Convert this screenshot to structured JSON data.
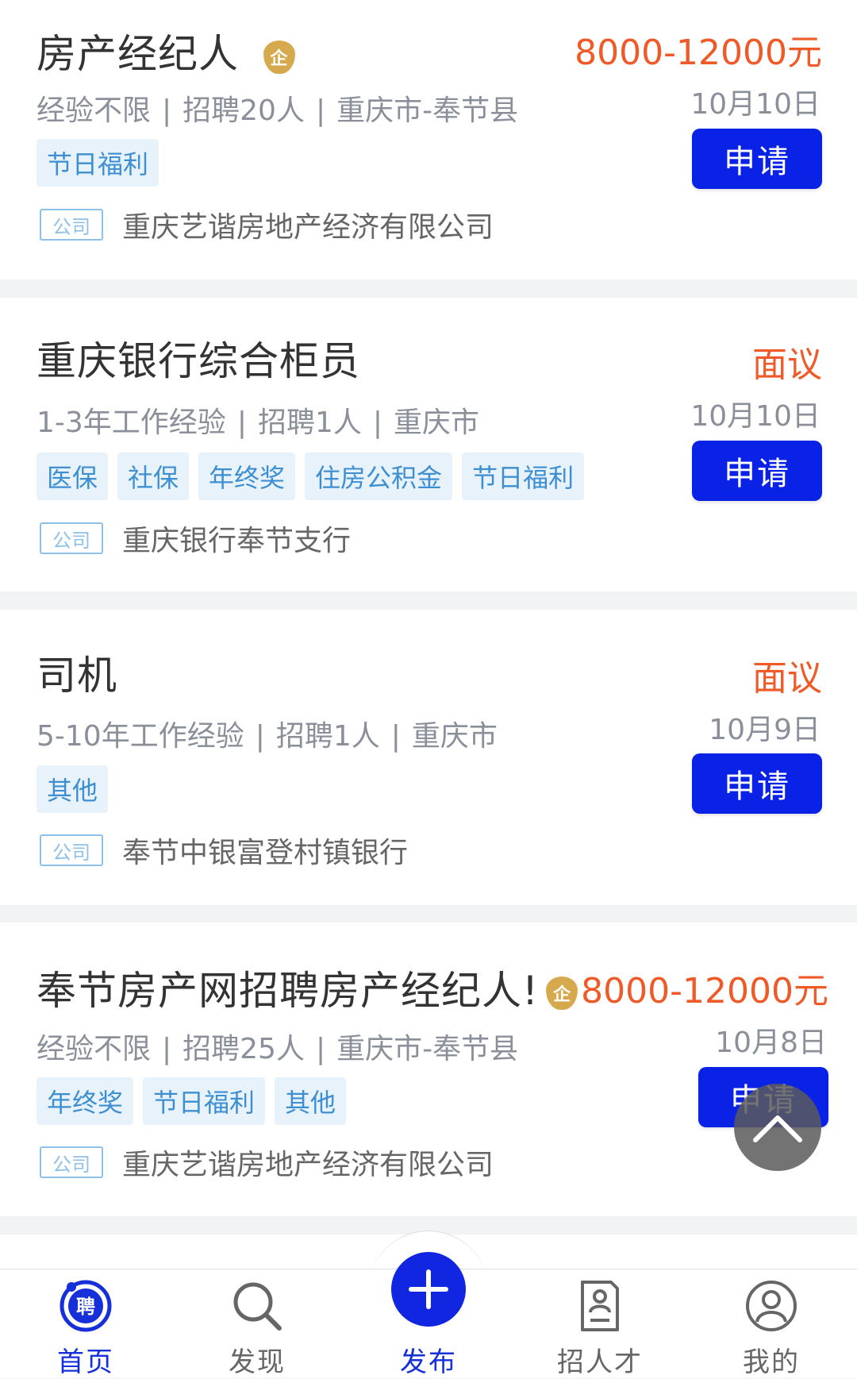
{
  "jobs": [
    {
      "title": "房产经纪人",
      "enterprise_badge": "企",
      "salary": "8000-12000元",
      "experience": "经验不限",
      "headcount": "招聘20人",
      "location": "重庆市-奉节县",
      "date": "10月10日",
      "apply_label": "申请",
      "tags": [
        "节日福利"
      ],
      "company_badge": "公司",
      "company": "重庆艺谐房地产经济有限公司"
    },
    {
      "title": "重庆银行综合柜员",
      "salary": "面议",
      "experience": "1-3年工作经验",
      "headcount": "招聘1人",
      "location": "重庆市",
      "date": "10月10日",
      "apply_label": "申请",
      "tags": [
        "医保",
        "社保",
        "年终奖",
        "住房公积金",
        "节日福利"
      ],
      "company_badge": "公司",
      "company": "重庆银行奉节支行"
    },
    {
      "title": "司机",
      "salary": "面议",
      "experience": "5-10年工作经验",
      "headcount": "招聘1人",
      "location": "重庆市",
      "date": "10月9日",
      "apply_label": "申请",
      "tags": [
        "其他"
      ],
      "company_badge": "公司",
      "company": "奉节中银富登村镇银行"
    },
    {
      "title": "奉节房产网招聘房产经纪人!",
      "enterprise_badge": "企",
      "salary": "8000-12000元",
      "experience": "经验不限",
      "headcount": "招聘25人",
      "location": "重庆市-奉节县",
      "date": "10月8日",
      "apply_label": "申请",
      "tags": [
        "年终奖",
        "节日福利",
        "其他"
      ],
      "company_badge": "公司",
      "company": "重庆艺谐房地产经济有限公司"
    }
  ],
  "meta_separator": "|",
  "tabbar": {
    "home": {
      "label": "首页",
      "icon": "recruit-logo-icon",
      "icon_text": "聘"
    },
    "discover": {
      "label": "发现",
      "icon": "search-icon"
    },
    "publish": {
      "label": "发布",
      "icon": "plus-icon"
    },
    "talent": {
      "label": "招人才",
      "icon": "resume-icon"
    },
    "mine": {
      "label": "我的",
      "icon": "user-icon"
    }
  },
  "colors": {
    "accent": "#0a21e6",
    "salary": "#ef5a28",
    "tag_text": "#3d8fd1",
    "tag_bg": "#e8f2fb",
    "enterprise_badge": "#d7a94e",
    "active_tab": "#1530d8"
  }
}
